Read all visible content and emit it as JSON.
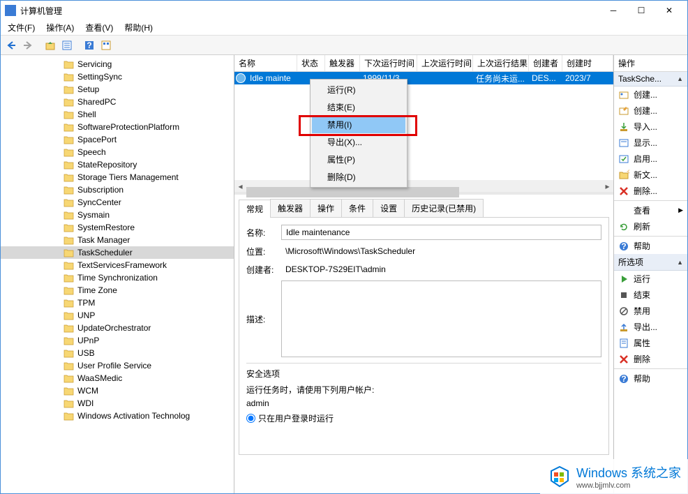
{
  "window": {
    "title": "计算机管理"
  },
  "menubar": [
    {
      "label": "文件(F)"
    },
    {
      "label": "操作(A)"
    },
    {
      "label": "查看(V)"
    },
    {
      "label": "帮助(H)"
    }
  ],
  "tree": [
    "Servicing",
    "SettingSync",
    "Setup",
    "SharedPC",
    "Shell",
    "SoftwareProtectionPlatform",
    "SpacePort",
    "Speech",
    "StateRepository",
    "Storage Tiers Management",
    "Subscription",
    "SyncCenter",
    "Sysmain",
    "SystemRestore",
    "Task Manager",
    "TaskScheduler",
    "TextServicesFramework",
    "Time Synchronization",
    "Time Zone",
    "TPM",
    "UNP",
    "UpdateOrchestrator",
    "UPnP",
    "USB",
    "User Profile Service",
    "WaaSMedic",
    "WCM",
    "WDI",
    "Windows Activation Technolog"
  ],
  "tree_selected": "TaskScheduler",
  "list": {
    "columns": [
      "名称",
      "状态",
      "触发器",
      "下次运行时间",
      "上次运行时间",
      "上次运行结果",
      "创建者",
      "创建时"
    ],
    "row": {
      "name": "Idle mainte",
      "next": "1999/11/3...",
      "result": "任务尚未运...",
      "creator": "DES...",
      "created": "2023/7"
    }
  },
  "context_menu": [
    "运行(R)",
    "结束(E)",
    "禁用(I)",
    "导出(X)...",
    "属性(P)",
    "删除(D)"
  ],
  "context_highlight": "禁用(I)",
  "details": {
    "tabs": [
      "常规",
      "触发器",
      "操作",
      "条件",
      "设置",
      "历史记录(已禁用)"
    ],
    "active_tab": "常规",
    "name_lbl": "名称:",
    "name": "Idle maintenance",
    "location_lbl": "位置:",
    "location": "\\Microsoft\\Windows\\TaskScheduler",
    "creator_lbl": "创建者:",
    "creator": "DESKTOP-7S29EIT\\admin",
    "desc_lbl": "描述:",
    "security_title": "安全选项",
    "security_hint": "运行任务时，请使用下列用户帐户:",
    "security_user": "admin",
    "radio1": "只在用户登录时运行"
  },
  "actions": {
    "header": "操作",
    "section1": "TaskSche...",
    "items1": [
      {
        "icon": "create-basic",
        "label": "创建..."
      },
      {
        "icon": "create",
        "label": "创建..."
      },
      {
        "icon": "import",
        "label": "导入..."
      },
      {
        "icon": "show",
        "label": "显示..."
      },
      {
        "icon": "enable",
        "label": "启用..."
      },
      {
        "icon": "newfolder",
        "label": "新文..."
      },
      {
        "icon": "delete",
        "label": "删除..."
      },
      {
        "icon": "view",
        "label": "查看",
        "arrow": true
      },
      {
        "icon": "refresh",
        "label": "刷新"
      },
      {
        "icon": "help",
        "label": "帮助"
      }
    ],
    "section2": "所选项",
    "items2": [
      {
        "icon": "run",
        "label": "运行"
      },
      {
        "icon": "end",
        "label": "结束"
      },
      {
        "icon": "disable",
        "label": "禁用"
      },
      {
        "icon": "export",
        "label": "导出..."
      },
      {
        "icon": "properties",
        "label": "属性"
      },
      {
        "icon": "delete",
        "label": "删除"
      },
      {
        "icon": "help",
        "label": "帮助"
      }
    ]
  },
  "watermark": {
    "text": "Windows 系统之家",
    "sub": "www.bjjmlv.com"
  }
}
